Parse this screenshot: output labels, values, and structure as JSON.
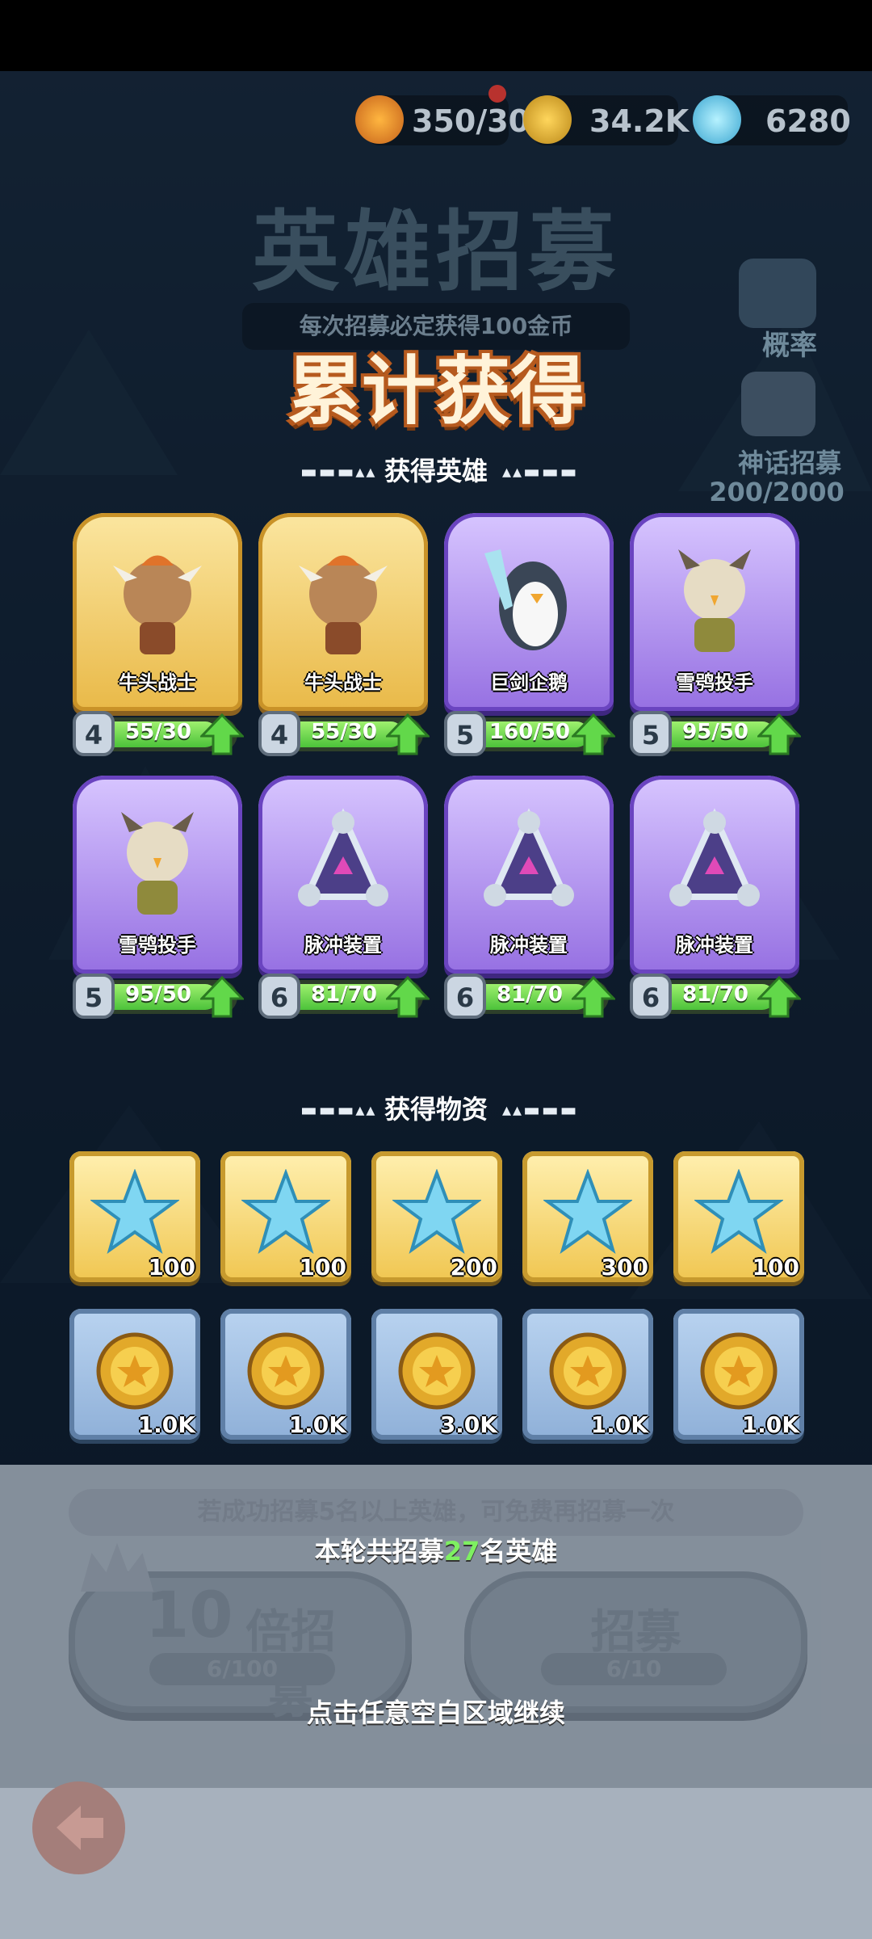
{
  "resources": [
    {
      "value": "350/30",
      "icon": "fire-drop-icon"
    },
    {
      "value": "34.2K",
      "icon": "gold-coin-icon"
    },
    {
      "value": "6280",
      "icon": "crystal-icon"
    }
  ],
  "background": {
    "title": "英雄招募",
    "subtitle": "每次招募必定获得100金币",
    "rate_label": "概率",
    "mythic_label": "神话招募",
    "mythic_progress": "200/2000"
  },
  "overlay": {
    "title": "累计获得",
    "heroes_section": "获得英雄",
    "items_section": "获得物资"
  },
  "heroes": [
    {
      "name": "牛头战士",
      "level": "4",
      "progress": "55/30",
      "rarity": "gold",
      "art": "bull-warrior-icon"
    },
    {
      "name": "牛头战士",
      "level": "4",
      "progress": "55/30",
      "rarity": "gold",
      "art": "bull-warrior-icon"
    },
    {
      "name": "巨剑企鹅",
      "level": "5",
      "progress": "160/50",
      "rarity": "purple",
      "art": "penguin-sword-icon"
    },
    {
      "name": "雪鸮投手",
      "level": "5",
      "progress": "95/50",
      "rarity": "purple",
      "art": "snow-owl-icon"
    },
    {
      "name": "雪鸮投手",
      "level": "5",
      "progress": "95/50",
      "rarity": "purple",
      "art": "snow-owl-icon"
    },
    {
      "name": "脉冲装置",
      "level": "6",
      "progress": "81/70",
      "rarity": "purple",
      "art": "pulse-device-icon"
    },
    {
      "name": "脉冲装置",
      "level": "6",
      "progress": "81/70",
      "rarity": "purple",
      "art": "pulse-device-icon"
    },
    {
      "name": "脉冲装置",
      "level": "6",
      "progress": "81/70",
      "rarity": "purple",
      "art": "pulse-device-icon"
    }
  ],
  "crystals": [
    "100",
    "100",
    "200",
    "300",
    "100"
  ],
  "coins": [
    "1.0K",
    "1.0K",
    "3.0K",
    "1.0K",
    "1.0K"
  ],
  "bottom": {
    "tip_text": "若成功招募5名以上英雄，可免费再招募一次",
    "summary_prefix": "本轮共招募",
    "summary_count": "27",
    "summary_suffix": "名英雄",
    "btn10_num": "10",
    "btn10_label": "倍招募",
    "btn10_cost": "6/100",
    "btn1_label": "招募",
    "btn1_cost": "6/10",
    "continue_text": "点击任意空白区域继续"
  }
}
